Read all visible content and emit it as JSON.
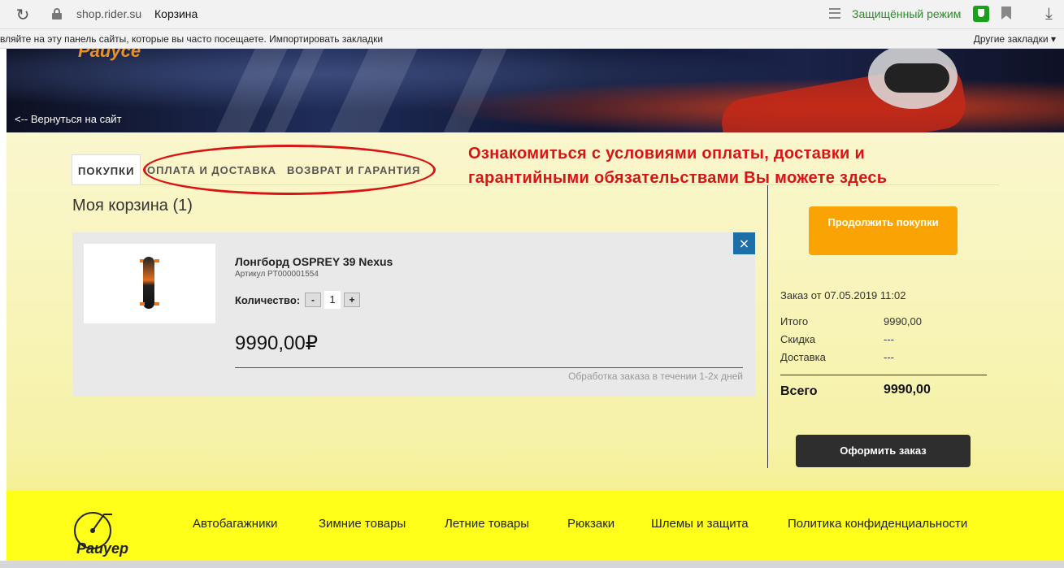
{
  "browser": {
    "domain": "shop.rider.su",
    "page_title": "Корзина",
    "protected_mode": "Защищённый режим",
    "bookmarks_hint": "вляйте на эту панель сайты, которые вы часто посещаете. Импортировать закладки",
    "other_bookmarks": "Другие закладки",
    "icons": [
      "reload-icon",
      "lock-icon",
      "reader-icon",
      "shield-icon",
      "bookmark-icon",
      "download-icon"
    ]
  },
  "header": {
    "logo_text": "Pauyce",
    "back_link": "<-- Вернуться на сайт"
  },
  "tabs": [
    {
      "label": "ПОКУПКИ",
      "active": true
    },
    {
      "label": "ОПЛАТА И ДОСТАВКА",
      "active": false
    },
    {
      "label": "ВОЗВРАТ И ГАРАНТИЯ",
      "active": false
    }
  ],
  "annotation": {
    "line1": "Ознакомиться с условиями оплаты, доставки и",
    "line2": "гарантийными обязательствами Вы можете здесь",
    "color": "#d81414"
  },
  "cart": {
    "title": "Моя корзина (1)",
    "item": {
      "name": "Лонгборд OSPREY 39 Nexus",
      "sku": "Артикул PT000001554",
      "qty_label": "Количество:",
      "qty_minus": "-",
      "qty": "1",
      "qty_plus": "+",
      "price": "9990,00₽",
      "processing": "Обработка заказа в течении 1-2х дней",
      "remove": "×"
    }
  },
  "summary": {
    "continue_label": "Продолжить покупки",
    "order_date": "Заказ от 07.05.2019 11:02",
    "rows": [
      {
        "label": "Итого",
        "value": "9990,00"
      },
      {
        "label": "Скидка",
        "value": "---"
      },
      {
        "label": "Доставка",
        "value": "---"
      }
    ],
    "total_label": "Всего",
    "total_value": "9990,00",
    "checkout_label": "Оформить заказ"
  },
  "footer": {
    "logo_text": "Pauyep",
    "nav": [
      "Автобагажники",
      "Зимние товары",
      "Летние товары",
      "Рюкзаки",
      "Шлемы и защита",
      "Политика конфиденциальности"
    ]
  },
  "colors": {
    "accent_orange": "#f9a404",
    "close_blue": "#1e6ea7",
    "footer_yellow": "#ffff1a",
    "checkout_dark": "#2e2e2e"
  }
}
